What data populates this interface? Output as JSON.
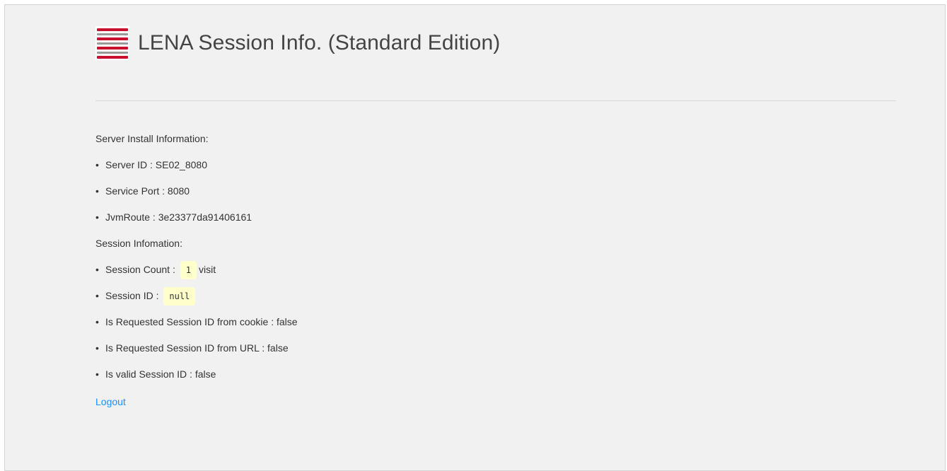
{
  "header": {
    "title": "LENA Session Info. (Standard Edition)",
    "logo_icon": "lena-stripes-logo-icon"
  },
  "server_section": {
    "heading": "Server Install Information:",
    "items": [
      {
        "label": "Server ID : ",
        "value": "SE02_8080"
      },
      {
        "label": "Service Port : ",
        "value": "8080"
      },
      {
        "label": "JvmRoute : ",
        "value": "3e23377da91406161"
      }
    ]
  },
  "session_section": {
    "heading": "Session Infomation:",
    "session_count": {
      "label": "Session Count : ",
      "value": "1",
      "suffix": "visit"
    },
    "session_id": {
      "label": "Session ID : ",
      "value": "null"
    },
    "items": [
      {
        "label": "Is Requested Session ID from cookie : ",
        "value": "false"
      },
      {
        "label": "Is Requested Session ID from URL : ",
        "value": "false"
      },
      {
        "label": "Is valid Session ID : ",
        "value": "false"
      }
    ]
  },
  "logout_label": "Logout",
  "colors": {
    "background": "#f1f1f1",
    "logo_red": "#c8102e",
    "logo_gray": "#9a9a9a",
    "link": "#1e90ff",
    "code_background": "#ffffcc"
  }
}
